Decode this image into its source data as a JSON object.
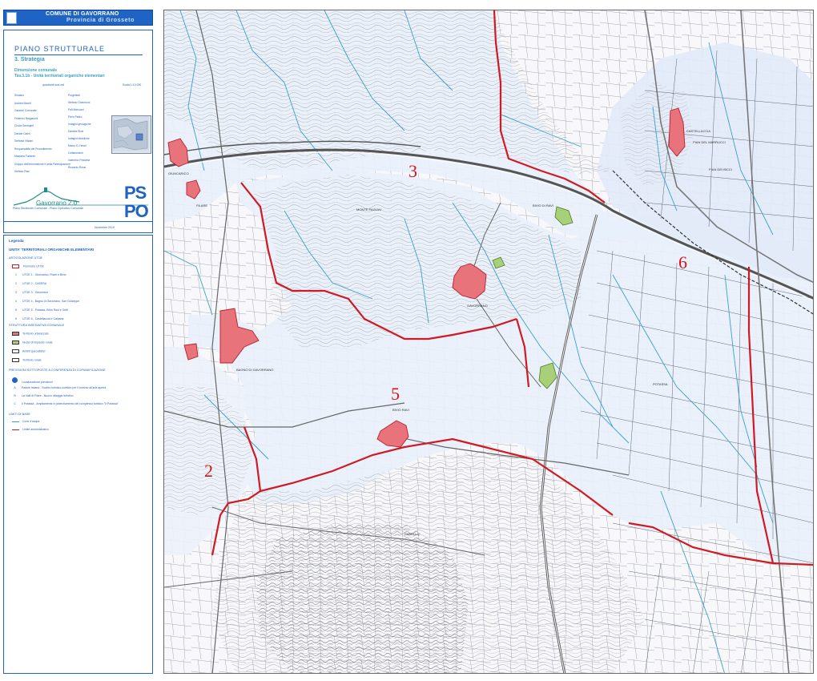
{
  "header": {
    "municipality": "COMUNE DI GAVORRANO",
    "province": "Provincia di Grosseto"
  },
  "plan": {
    "title": "PIANO STRUTTURALE",
    "section": "3. Strategia",
    "subtitle1": "Dimensione comunale",
    "subtitle2": "Tav.3.1b - Unità territoriali organiche elementari",
    "scale_left": "quadranti sud-est",
    "scale_right": "Scala 1:10.000",
    "credits_left": [
      "Sindaco",
      "Andrea Biondi",
      "Garante Comunale",
      "Federico Bargiacchi",
      "Cinzia Santopiet",
      "Davide Caleri",
      "Stefania Vitzani",
      "Responsabile del Procedimento",
      "Massimo Fabbrini",
      "Gruppo dell'informazione e della Partecipazione",
      "Stefano Raci"
    ],
    "credits_right": [
      "Progettisti",
      "Stefano Giommoni",
      "Pali Marcuzzi",
      "Piero Padro",
      "Indagini geologiche",
      "Daniela Rizzi",
      "Indagini idrauliche",
      "Marco D. Hevel",
      "Collaboratori",
      "Valentino Pesseria",
      "Riccardo Rossi"
    ],
    "logo_name": "Gavorrano 2.0",
    "logo_caption": "Piano Strutturale Comunale - Piano Operativo Comunale",
    "ps": "PS",
    "po": "PO",
    "date": "Novembre 2019"
  },
  "legend": {
    "title": "Legenda",
    "section_title": "UNITA' TERRITORIALI ORGANICHE ELEMENTARI",
    "articulation_title": "ARTICOLAZIONE UTOE",
    "perimeter": "Perimetro UTOE",
    "utoe_items": [
      {
        "num": "1",
        "label": "UTOE 1 - Giuncarico, Filare e Bivio"
      },
      {
        "num": "2",
        "label": "UTOE 2 - CASERA"
      },
      {
        "num": "3",
        "label": "UTOE 3 - Gavorrano"
      },
      {
        "num": "4",
        "label": "UTOE 4 - Bagno di Gavorrano, San Giuseppe"
      },
      {
        "num": "5",
        "label": "UTOE 5 - Potassa, Bivio Ravi e Grilli"
      },
      {
        "num": "6",
        "label": "UTOE 6 - Castellaccia e Caldana"
      }
    ],
    "structure_title": "STRUTTURA INSEDIATIVA COMUNALE",
    "structure_items": [
      {
        "label": "Territorio urbanizzato",
        "color": "#e9737b"
      },
      {
        "label": "Nuclei di impianto rurale",
        "color": "#a8d078"
      },
      {
        "label": "Ambiti specialistici",
        "color": "#ffffff"
      },
      {
        "label": "Territorio rurale",
        "color": "#ffffff"
      }
    ],
    "provisions_title": "PREVISIONI SOTTOPOSTE A CONFERENZA DI COPIANIFICAZIONE",
    "provisions": [
      {
        "mark": "",
        "label": "Localizzazione previsioni"
      },
      {
        "mark": "A",
        "label": "Padule Istiana - Nucleo turistico-ricettivo per il turismo all'aria aperta"
      },
      {
        "mark": "B",
        "label": "La Valli di Filare - Nuovo villaggio turistico"
      },
      {
        "mark": "C",
        "label": "Il Potassa - Ampliamento e potenziamento del complesso turistico \"Il Potassa\""
      }
    ],
    "base_title": "LIMITI DI BASE",
    "base_items": [
      {
        "label": "Corsi d'acqua",
        "color": "#3aa0c8"
      },
      {
        "label": "Limite amministrativo",
        "color": "#cf1a24"
      }
    ]
  },
  "map": {
    "utoe_labels": [
      "2",
      "3",
      "5",
      "6"
    ],
    "place_names": [
      "CASTELLACCIA",
      "PIAN DEL MARRUCCI",
      "BIVIO RAVI",
      "GAVORRANO",
      "BAGNO DI GAVORRANO",
      "FILARE",
      "GIUNCARICO",
      "POTASSA",
      "MONTE PAGLIAI",
      "CASELLO",
      "PIAN DEI BICCI",
      "BIVIO DI RAVI"
    ],
    "colors": {
      "urban": "#e9737b",
      "rural_nuclei": "#a8d078",
      "utoe_fill": "#e8effb",
      "boundary": "#cf1a24",
      "river": "#3aa0c8",
      "road": "#555555",
      "accent": "#1f63c4"
    }
  }
}
